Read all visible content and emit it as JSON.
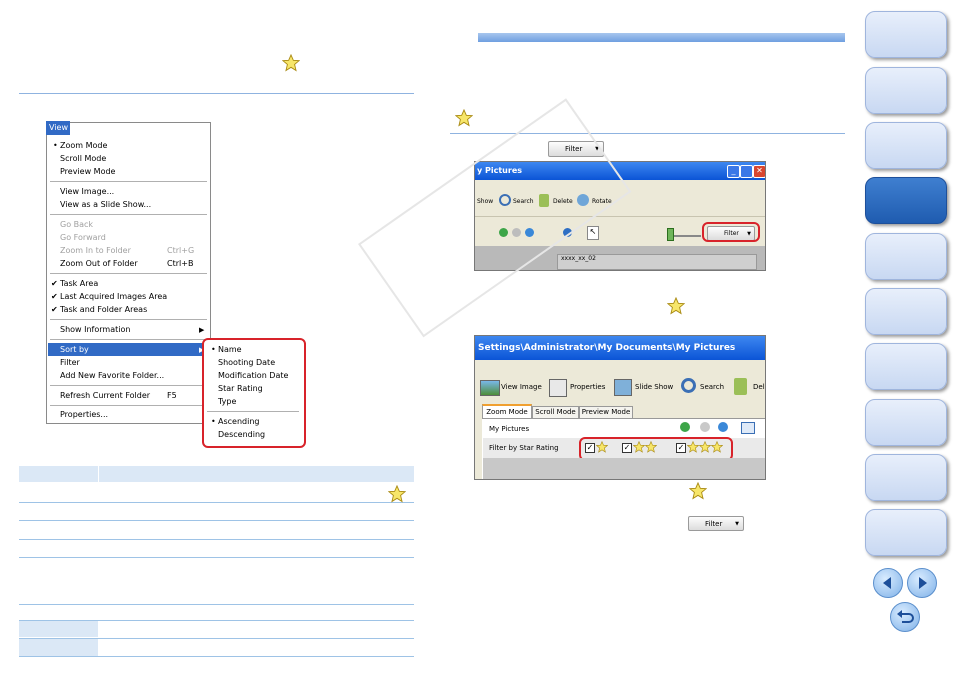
{
  "view_menu": {
    "title": "View",
    "items": {
      "zoom_mode": "Zoom Mode",
      "scroll_mode": "Scroll Mode",
      "preview_mode": "Preview Mode",
      "view_image": "View Image...",
      "view_slide_show": "View as a Slide Show...",
      "go_back": "Go Back",
      "go_forward": "Go Forward",
      "zoom_in_folder": "Zoom In to Folder",
      "zoom_in_shortcut": "Ctrl+G",
      "zoom_out_folder": "Zoom Out of Folder",
      "zoom_out_shortcut": "Ctrl+B",
      "task_area": "Task Area",
      "last_acquired": "Last Acquired Images Area",
      "task_folder_areas": "Task and Folder Areas",
      "show_information": "Show Information",
      "sort_by": "Sort by",
      "filter": "Filter",
      "add_favorite": "Add New Favorite Folder...",
      "refresh_folder": "Refresh Current Folder",
      "refresh_shortcut": "F5",
      "properties": "Properties..."
    },
    "submenu": {
      "name": "Name",
      "shooting_date": "Shooting Date",
      "modification_date": "Modification Date",
      "star_rating": "Star Rating",
      "type": "Type",
      "ascending": "Ascending",
      "descending": "Descending"
    }
  },
  "filter_button_label": "Filter",
  "top_screenshot": {
    "window_title": "y Pictures",
    "toolbar": {
      "show": "Show",
      "search": "Search",
      "delete": "Delete",
      "rotate": "Rotate",
      "filter": "Filter"
    },
    "thumb_label": "xxxx_xx_02"
  },
  "bottom_screenshot": {
    "path": "Settings\\Administrator\\My Documents\\My Pictures",
    "toolbar": {
      "view_image": "View Image",
      "properties": "Properties",
      "slide_show": "Slide Show",
      "search": "Search",
      "del": "Del"
    },
    "tabs": [
      "Zoom Mode",
      "Scroll Mode",
      "Preview Mode"
    ],
    "folder_label": "My Pictures",
    "filter_label": "Filter by Star Rating"
  },
  "colors": {
    "accent_blue": "#316ac5",
    "highlight_red": "#d8232a",
    "nav_active": "#2a6abf",
    "rule_blue": "#8fb3e0"
  }
}
